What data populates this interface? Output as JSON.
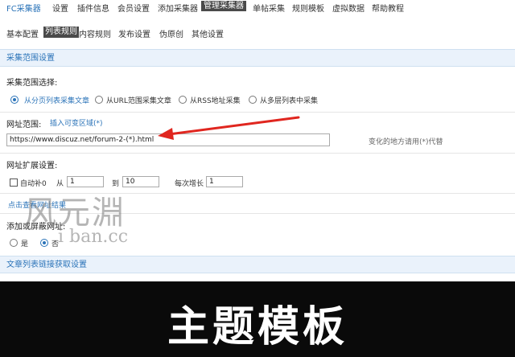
{
  "top_nav": {
    "brand": "FC采集器",
    "items": [
      "设置",
      "插件信息",
      "会员设置",
      "添加采集器",
      "管理采集器",
      "单帖采集",
      "规则模板",
      "虚拟数据",
      "帮助教程"
    ]
  },
  "sub_nav": {
    "items": [
      "基本配置",
      "列表规则",
      "内容规则",
      "发布设置",
      "伪原创",
      "其他设置"
    ]
  },
  "section1": {
    "title": "采集范围设置",
    "scope_label": "采集范围选择:",
    "options": [
      "从分页列表采集文章",
      "从URL范围采集文章",
      "从RSS地址采集",
      "从多层列表中采集"
    ],
    "selected": 0
  },
  "url_range": {
    "label": "网址范围:",
    "insert_link": "插入可变区域(*)",
    "value": "https://www.discuz.net/forum-2-(*).html",
    "hint": "变化的地方请用(*)代替"
  },
  "expand": {
    "label": "网址扩展设置:",
    "auto_pad": "自动补0",
    "from_label": "从",
    "from_value": "1",
    "to_label": "到",
    "to_value": "10",
    "step_label": "每次增长",
    "step_value": "1",
    "preview_link": "点击查看网址结果"
  },
  "add_screen": {
    "label": "添加或屏蔽网址:",
    "yes": "是",
    "no": "否"
  },
  "section2": {
    "title": "文章列表链接获取设置"
  },
  "watermark": {
    "line1": "风元淵",
    "line2": "i ban.cc"
  },
  "banner": {
    "title": "主题模板"
  },
  "colors": {
    "accent": "#2a73b8",
    "arrow": "#e0261f",
    "banner_bg": "#0a0a0a"
  }
}
